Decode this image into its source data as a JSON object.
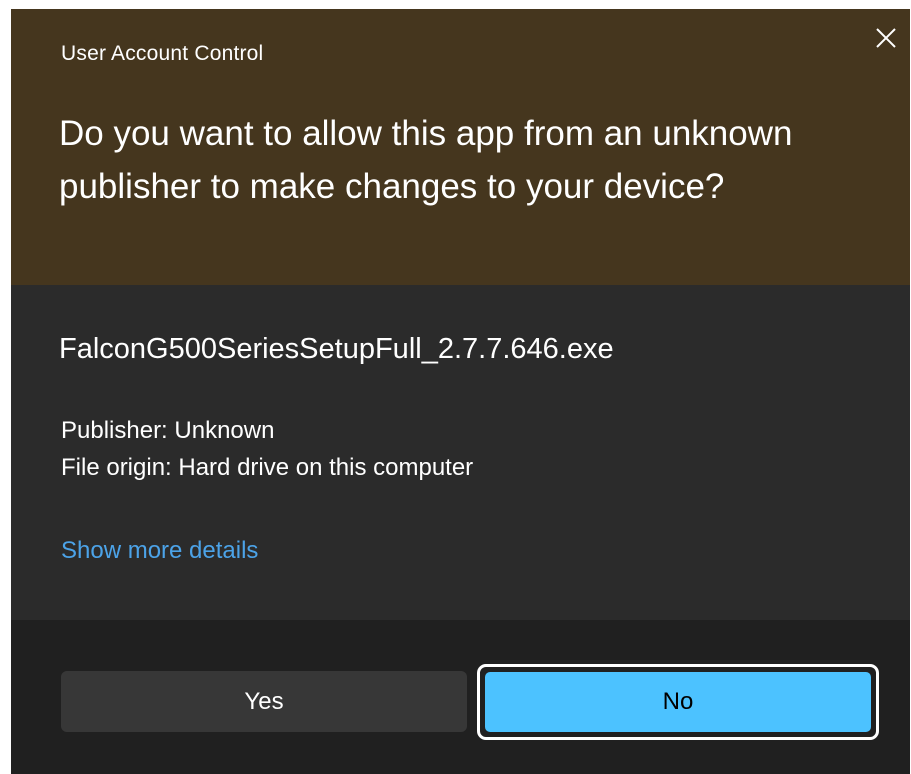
{
  "dialog": {
    "title": "User Account Control",
    "question": "Do you want to allow this app from an unknown publisher to make changes to your device?",
    "close_icon": "close-icon"
  },
  "app": {
    "filename": "FalconG500SeriesSetupFull_2.7.7.646.exe",
    "publisher": "Publisher: Unknown",
    "origin": "File origin: Hard drive on this computer",
    "details_link": "Show more details"
  },
  "buttons": {
    "yes": "Yes",
    "no": "No"
  },
  "colors": {
    "header_bg": "#45361e",
    "body_bg": "#2b2b2b",
    "footer_bg": "#202020",
    "link": "#4ca3e8",
    "primary_button": "#4cc2ff"
  }
}
